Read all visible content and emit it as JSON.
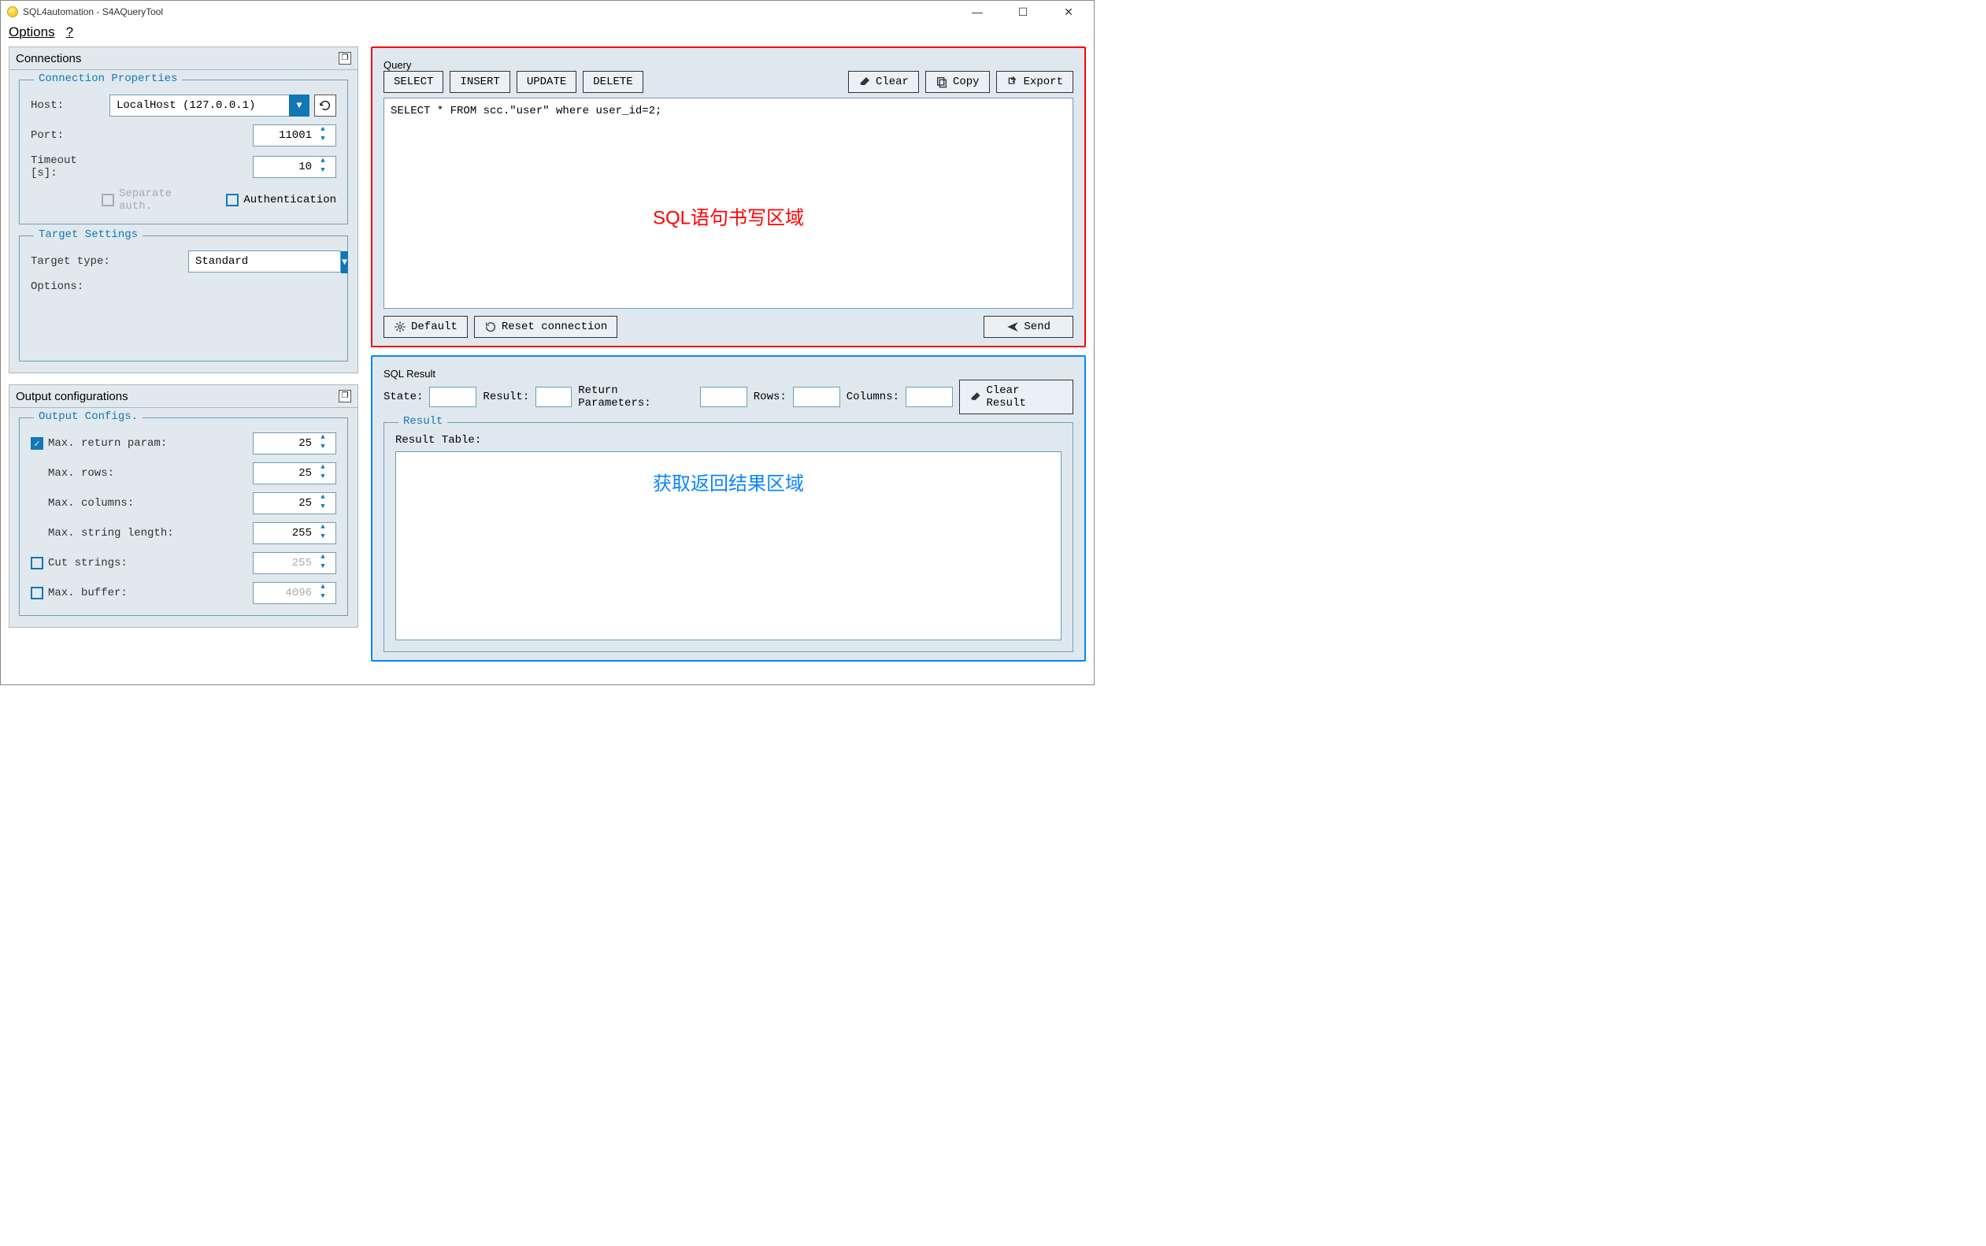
{
  "titlebar": {
    "title": "SQL4automation - S4AQueryTool"
  },
  "menubar": {
    "options": "Options",
    "help": "?"
  },
  "connections": {
    "header": "Connections",
    "group_label": "Connection Properties",
    "host_label": "Host:",
    "host_value": "LocalHost (127.0.0.1)",
    "port_label": "Port:",
    "port_value": "11001",
    "timeout_label": "Timeout [s]:",
    "timeout_value": "10",
    "separate_auth": "Separate auth.",
    "authentication": "Authentication",
    "target_group_label": "Target Settings",
    "target_type_label": "Target type:",
    "target_type_value": "Standard",
    "options_label": "Options:"
  },
  "output": {
    "header": "Output configurations",
    "group_label": "Output Configs.",
    "max_return_param": "Max. return param:",
    "max_return_param_value": "25",
    "max_rows": "Max. rows:",
    "max_rows_value": "25",
    "max_columns": "Max. columns:",
    "max_columns_value": "25",
    "max_string_length": "Max. string length:",
    "max_string_length_value": "255",
    "cut_strings": "Cut strings:",
    "cut_strings_value": "255",
    "max_buffer": "Max. buffer:",
    "max_buffer_value": "4096"
  },
  "query": {
    "group_label": "Query",
    "select_btn": "SELECT",
    "insert_btn": "INSERT",
    "update_btn": "UPDATE",
    "delete_btn": "DELETE",
    "clear_btn": "Clear",
    "copy_btn": "Copy",
    "export_btn": "Export",
    "sql_text": "SELECT * FROM scc.\"user\" where user_id=2;",
    "overlay_text": "SQL语句书写区域",
    "default_btn": "Default",
    "reset_btn": "Reset connection",
    "send_btn": "Send"
  },
  "sqlresult": {
    "group_label": "SQL Result",
    "state_label": "State:",
    "result_label": "Result:",
    "return_params_label": "Return Parameters:",
    "rows_label": "Rows:",
    "columns_label": "Columns:",
    "clear_result_btn": "Clear Result",
    "result_inner_label": "Result",
    "result_table_label": "Result Table:",
    "overlay_text": "获取返回结果区域"
  }
}
